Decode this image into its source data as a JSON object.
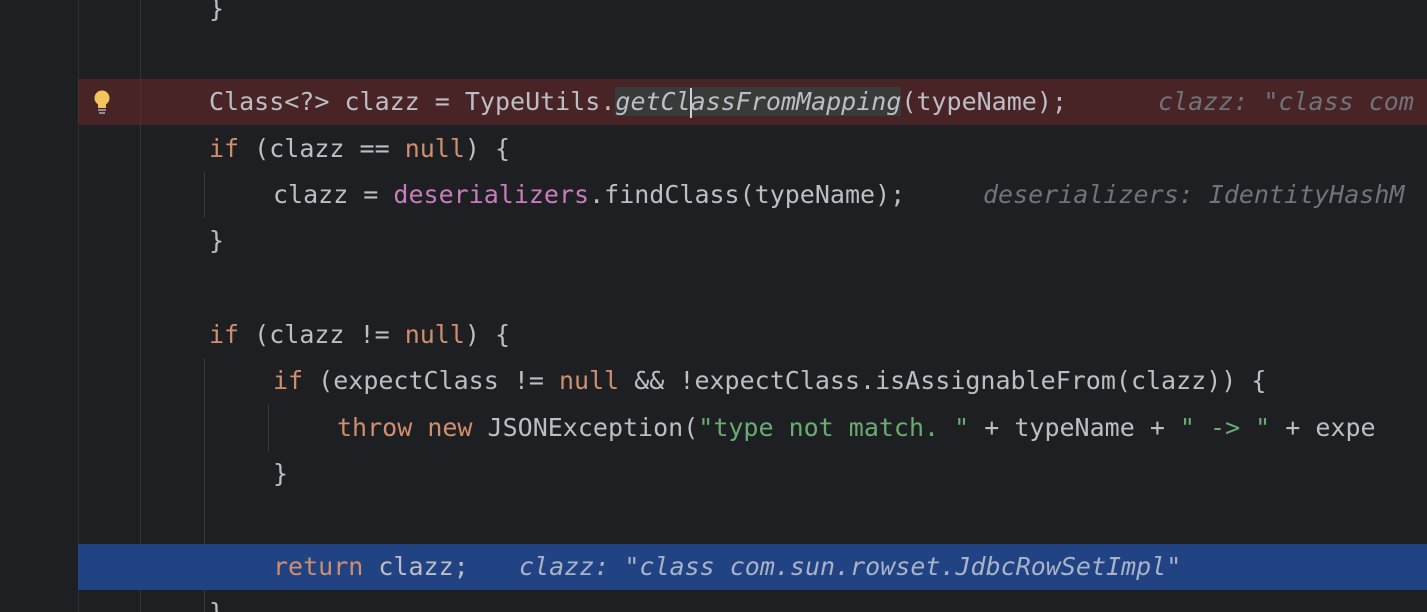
{
  "editor": {
    "lines": {
      "brace_top": "}",
      "l1": {
        "a": "Class<?> clazz = TypeUtils.",
        "method_a": "getCl",
        "method_b": "assFromMapping",
        "b": "(typeName);",
        "hint": "clazz: \"class com"
      },
      "l2": {
        "kw": "if",
        "a": " (clazz == ",
        "nul": "null",
        "b": ") {"
      },
      "l3": {
        "a": "clazz = ",
        "field": "deserializers",
        "b": ".findClass(typeName);",
        "hint": "deserializers: IdentityHashM"
      },
      "l4": "}",
      "l5": {
        "kw": "if",
        "a": " (clazz != ",
        "nul": "null",
        "b": ") {"
      },
      "l6": {
        "kw": "if",
        "a": " (expectClass != ",
        "nul": "null",
        "b": " && !expectClass.isAssignableFrom(clazz)) {"
      },
      "l7": {
        "kw1": "throw",
        "kw2": "new",
        "a": " JSONException(",
        "s1": "\"type not match. \"",
        "b": " + typeName + ",
        "s2": "\" -> \"",
        "c": " + expe"
      },
      "l8": "}",
      "l9": {
        "kw": "return",
        "a": " clazz;",
        "hint": "clazz: \"class com.sun.rowset.JdbcRowSetImpl\""
      },
      "brace_bottom": "}"
    },
    "icons": {
      "intention": "lightbulb-icon"
    },
    "colors": {
      "background": "#1e1f22",
      "keyword": "#cf8e6d",
      "field": "#c77dbb",
      "string": "#6aab73",
      "breakpoint_line": "#4a2a2c",
      "execution_line": "#214283"
    }
  }
}
